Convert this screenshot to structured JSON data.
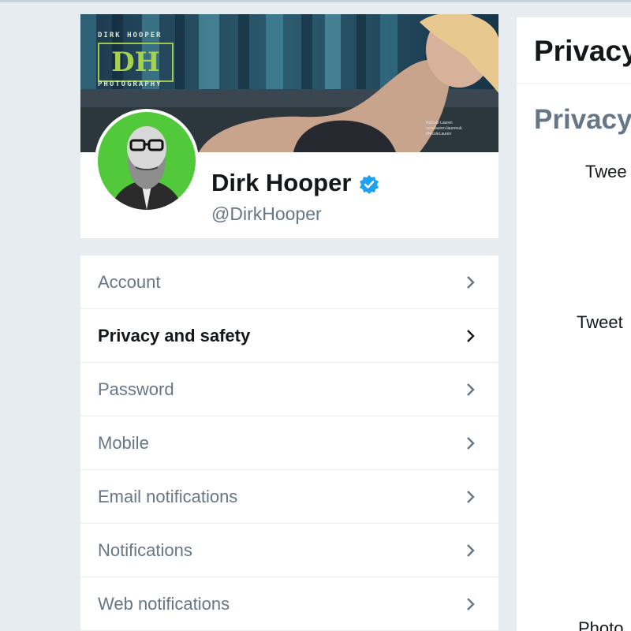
{
  "profile": {
    "display_name": "Dirk Hooper",
    "handle": "@DirkHooper",
    "banner": {
      "logo_top_text": "DIRK HOOPER",
      "logo_mark": "DH",
      "logo_bottom_text": "PHOTOGRAPHY",
      "caption_lines": [
        "Nichole Lauren",
        "nevalauren-laurenuk",
        "#NicoleLauren"
      ]
    },
    "colors": {
      "avatar_bg": "#51c93a",
      "verified": "#1da1f2"
    }
  },
  "nav": {
    "items": [
      {
        "label": "Account",
        "active": false
      },
      {
        "label": "Privacy and safety",
        "active": true
      },
      {
        "label": "Password",
        "active": false
      },
      {
        "label": "Mobile",
        "active": false
      },
      {
        "label": "Email notifications",
        "active": false
      },
      {
        "label": "Notifications",
        "active": false
      },
      {
        "label": "Web notifications",
        "active": false
      }
    ]
  },
  "content": {
    "title": "Privacy",
    "section_title": "Privacy",
    "row_labels": [
      "Twee",
      "Tweet",
      "Photo"
    ]
  }
}
